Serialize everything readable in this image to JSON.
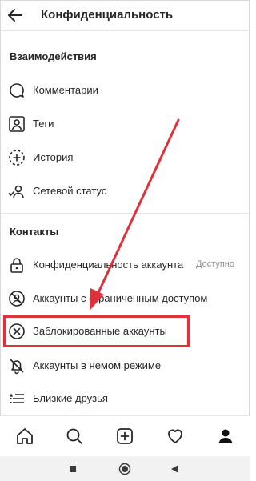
{
  "header": {
    "title": "Конфиденциальность",
    "back_icon": "arrow-left-icon"
  },
  "sections": {
    "interactions": {
      "title": "Взаимодействия",
      "items": [
        {
          "label": "Комментарии",
          "icon": "comment-icon"
        },
        {
          "label": "Теги",
          "icon": "tag-person-icon"
        },
        {
          "label": "История",
          "icon": "story-plus-icon"
        },
        {
          "label": "Сетевой статус",
          "icon": "activity-status-icon"
        }
      ]
    },
    "contacts": {
      "title": "Контакты",
      "items": [
        {
          "label": "Конфиденциальность аккаунта",
          "aux": "Доступно",
          "icon": "lock-icon"
        },
        {
          "label": "Аккаунты с ограниченным доступом",
          "icon": "restricted-icon"
        },
        {
          "label": "Заблокированные аккаунты",
          "icon": "blocked-icon"
        },
        {
          "label": "Аккаунты в немом режиме",
          "icon": "muted-bell-icon"
        },
        {
          "label": "Близкие друзья",
          "icon": "close-friends-list-icon"
        }
      ]
    }
  },
  "annotation": {
    "highlight_color": "#e0303b",
    "arrow_color": "#e0303b"
  },
  "tabbar": [
    "home-icon",
    "search-icon",
    "add-post-icon",
    "heart-icon",
    "profile-icon"
  ],
  "system_nav": [
    "recents-square-icon",
    "home-circle-icon",
    "back-triangle-icon"
  ]
}
